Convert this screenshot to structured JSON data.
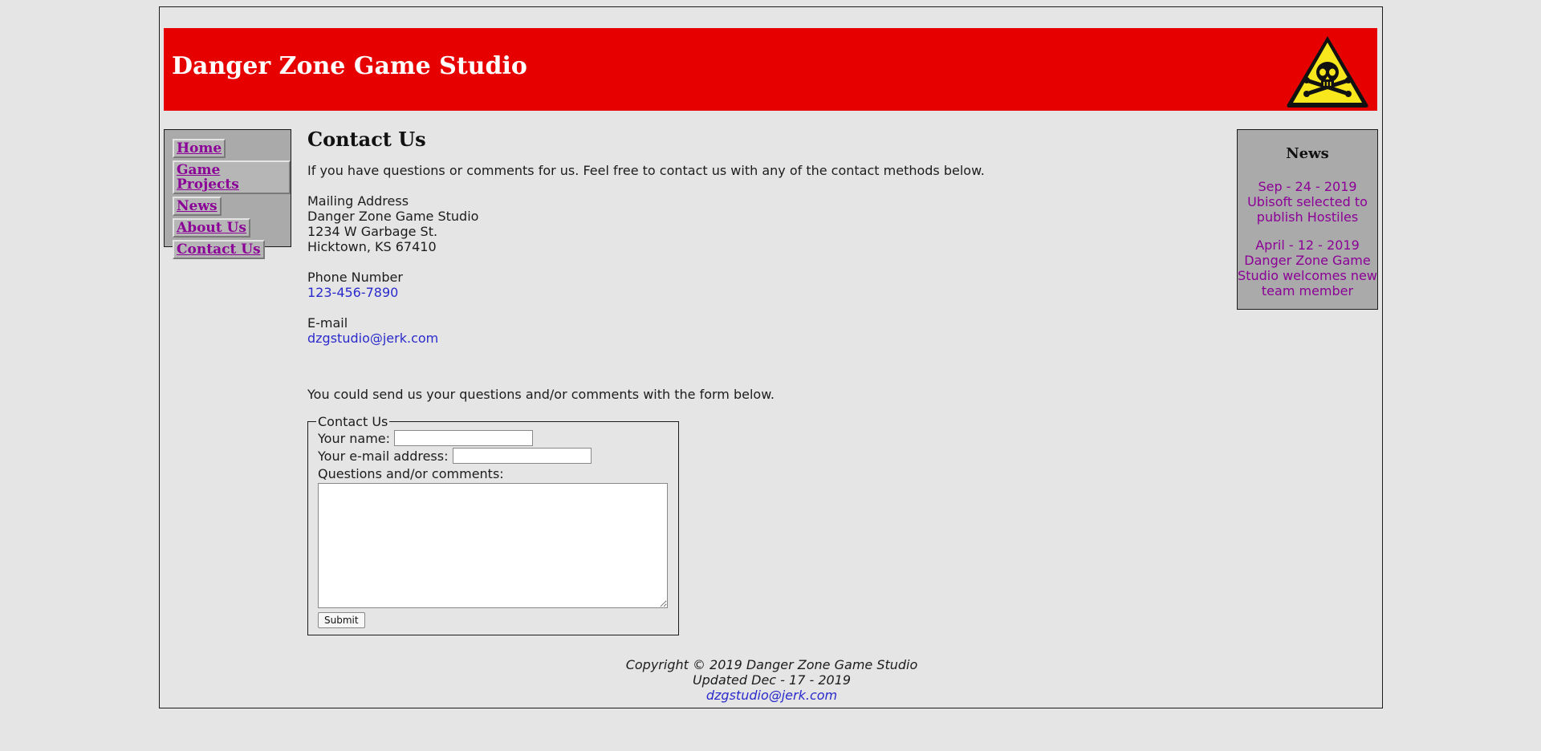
{
  "site": {
    "title": "Danger Zone Game Studio",
    "accent_color": "#e60000",
    "logo_icon": "skull-crossbones-warning-icon"
  },
  "nav": {
    "items": [
      {
        "label": "Home"
      },
      {
        "label": "Game Projects"
      },
      {
        "label": "News"
      },
      {
        "label": "About Us"
      },
      {
        "label": "Contact Us"
      }
    ]
  },
  "main": {
    "title": "Contact Us",
    "intro": "If you have questions or comments for us. Feel free to contact us with any of the contact methods below.",
    "mailing": {
      "label": "Mailing Address",
      "line1": "Danger Zone Game Studio",
      "line2": "1234 W Garbage St.",
      "line3": "Hicktown, KS 67410"
    },
    "phone": {
      "label": "Phone Number",
      "value": "123-456-7890"
    },
    "email": {
      "label": "E-mail",
      "value": "dzgstudio@jerk.com"
    },
    "form_intro": "You could send us your questions and/or comments with the form below."
  },
  "form": {
    "legend": "Contact Us",
    "name_label": "Your name:",
    "name_value": "",
    "email_label": "Your e-mail address:",
    "email_value": "",
    "comments_label": "Questions and/or comments:",
    "comments_value": "",
    "submit_label": "Submit"
  },
  "news": {
    "title": "News",
    "items": [
      {
        "text": "Sep - 24 - 2019 Ubisoft selected to publish Hostiles"
      },
      {
        "text": "April - 12 - 2019 Danger Zone Game Studio welcomes new team member"
      }
    ]
  },
  "footer": {
    "copyright": "Copyright © 2019 Danger Zone Game Studio",
    "updated": "Updated Dec - 17 - 2019",
    "email": "dzgstudio@jerk.com"
  }
}
